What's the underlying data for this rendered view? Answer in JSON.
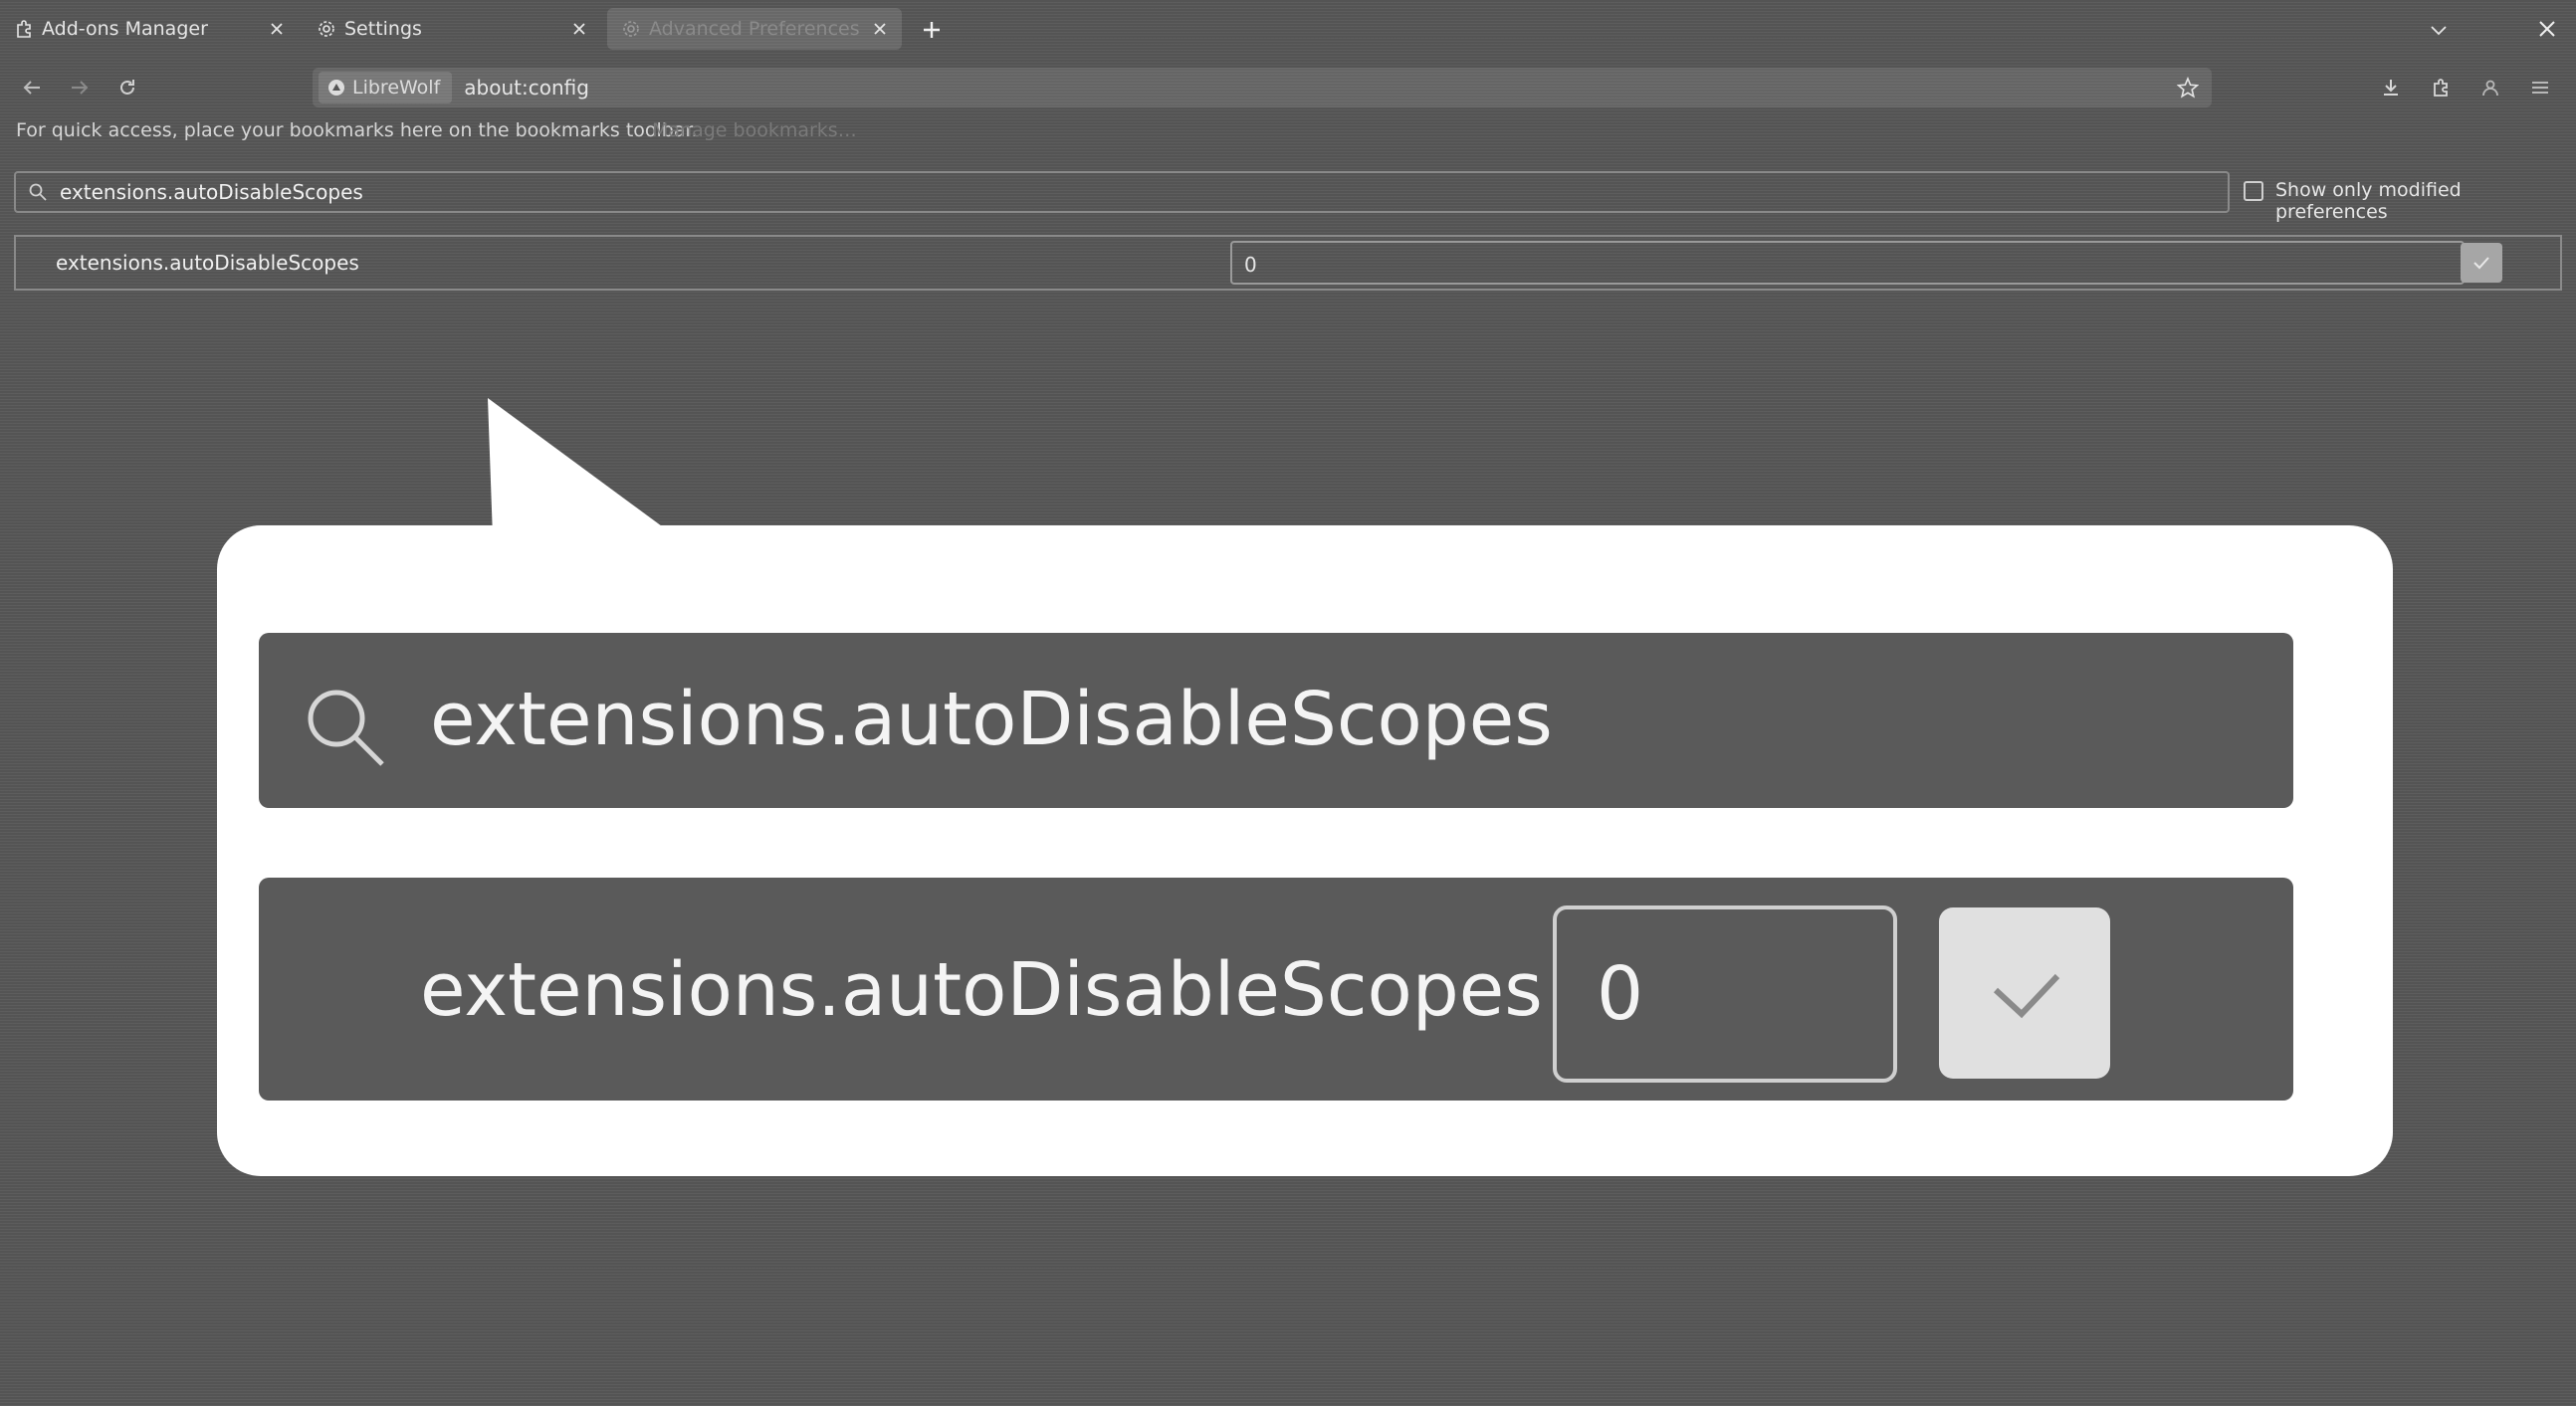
{
  "tabs": [
    {
      "label": "Add-ons Manager",
      "icon": "puzzle-icon"
    },
    {
      "label": "Settings",
      "icon": "gear-icon"
    },
    {
      "label": "Advanced Preferences",
      "icon": "gear-icon",
      "active": true
    }
  ],
  "navbar": {
    "identity_label": "LibreWolf",
    "url": "about:config"
  },
  "bookmarks_bar": {
    "text": "For quick access, place your bookmarks here on the bookmarks toolbar.",
    "link": "Manage bookmarks…"
  },
  "config": {
    "search_value": "extensions.autoDisableScopes",
    "show_modified_label": "Show only modified preferences",
    "rows": [
      {
        "name": "extensions.autoDisableScopes",
        "value": "0"
      }
    ]
  },
  "zoom": {
    "search_value": "extensions.autoDisableScopes",
    "pref_name": "extensions.autoDisableScopes",
    "pref_value": "0"
  },
  "colors": {
    "background": "#545454",
    "callout": "#ffffff",
    "save_button": "#a6a6a6"
  }
}
